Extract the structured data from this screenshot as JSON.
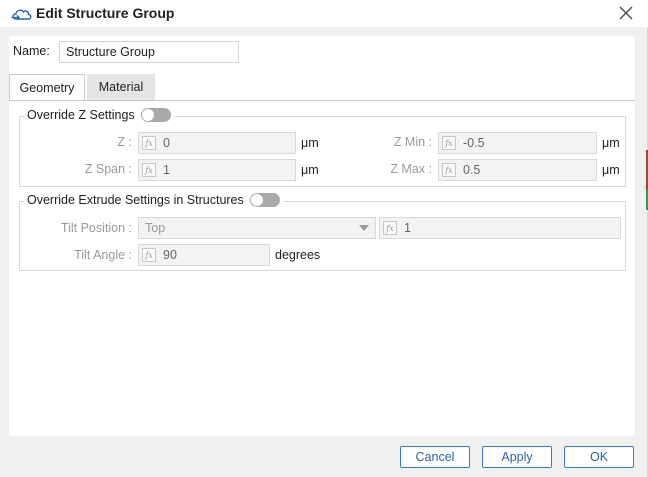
{
  "window": {
    "title": "Edit Structure Group",
    "icon": "cloud-arrow-icon",
    "close_icon": "close-icon"
  },
  "name": {
    "label": "Name:",
    "value": "Structure Group"
  },
  "tabs": [
    {
      "label": "Geometry",
      "active": true
    },
    {
      "label": "Material",
      "active": false
    }
  ],
  "override_z": {
    "label": "Override Z Settings",
    "enabled": false,
    "fields": {
      "z": {
        "label": "Z :",
        "value": "0",
        "unit": "μm"
      },
      "z_span": {
        "label": "Z Span :",
        "value": "1",
        "unit": "μm"
      },
      "z_min": {
        "label": "Z Min :",
        "value": "-0.5",
        "unit": "μm"
      },
      "z_max": {
        "label": "Z Max :",
        "value": "0.5",
        "unit": "μm"
      }
    }
  },
  "override_extrude": {
    "label": "Override Extrude Settings in Structures",
    "enabled": false,
    "tilt_position": {
      "label": "Tilt Position :",
      "selected": "Top",
      "value": "1"
    },
    "tilt_angle": {
      "label": "Tilt Angle :",
      "value": "90",
      "unit": "degrees"
    }
  },
  "fx_glyph": "fx",
  "buttons": {
    "cancel": "Cancel",
    "apply": "Apply",
    "ok": "OK"
  },
  "colors": {
    "accent": "#3e7bbd",
    "toggle_off": "#a9a9a9",
    "disabled_text": "#9a9a9a"
  }
}
